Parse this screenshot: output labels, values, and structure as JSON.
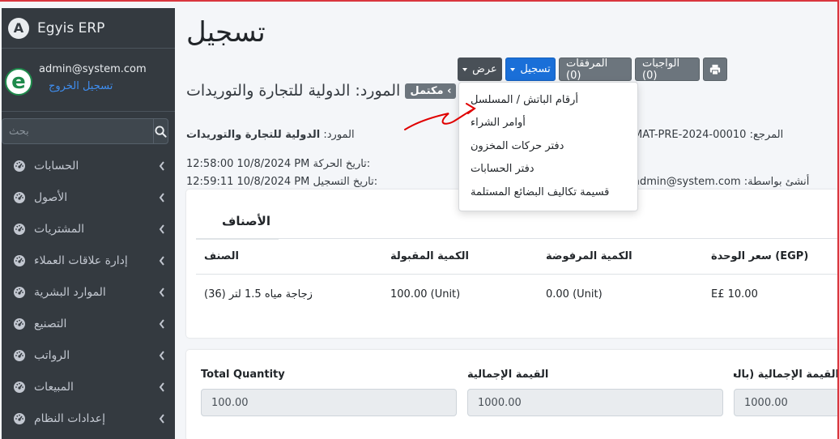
{
  "brand": {
    "name": "Egyis ERP",
    "logo_letter": "A"
  },
  "user": {
    "email": "admin@system.com",
    "logout": "تسجيل الخروج",
    "avatar_letter": "e"
  },
  "search": {
    "placeholder": "بحث"
  },
  "sidebar": {
    "items": [
      {
        "label": "الحسابات",
        "icon": "gauge-icon"
      },
      {
        "label": "الأصول",
        "icon": "gauge-icon"
      },
      {
        "label": "المشتريات",
        "icon": "gauge-icon"
      },
      {
        "label": "إدارة علاقات العملاء",
        "icon": "gauge-icon"
      },
      {
        "label": "الموارد البشرية",
        "icon": "gauge-icon"
      },
      {
        "label": "التصنيع",
        "icon": "gauge-icon"
      },
      {
        "label": "الرواتب",
        "icon": "gauge-icon"
      },
      {
        "label": "المبيعات",
        "icon": "gauge-icon"
      },
      {
        "label": "إعدادات النظام",
        "icon": "gauge-icon"
      }
    ]
  },
  "page": {
    "title": "تسجيل"
  },
  "toolbar": {
    "print_icon": "print-icon",
    "duties": "الواجبات (0)",
    "attachments": "المرفقات (0)",
    "register": "تسجيل",
    "view": "عرض"
  },
  "header": {
    "badge": "مكتمل ‹",
    "supplier": "المورد: الدولية للتجارة والتوريدات"
  },
  "info": {
    "supplier_label": "المورد:",
    "supplier_value": "الدولية للتجارة والتوريدات",
    "movement_date": "12:58:00 10/8/2024 PM تاريخ الحركة:",
    "register_date": "12:59:11 10/8/2024 PM تاريخ التسجيل:",
    "reference": "MAT-PRE-2024-00010 :المرجع",
    "created_by": "admin@system.com :أنشئ بواسطة"
  },
  "dropdown": {
    "items": [
      "أرقام الباتش / المسلسل",
      "أوامر الشراء",
      "دفتر حركات المخزون",
      "دفتر الحسابات",
      "قسيمة تكاليف البضائع المستلمة"
    ]
  },
  "items_tab": {
    "label": "الأصناف"
  },
  "table": {
    "headers": [
      "الصنف",
      "الكمية المقبولة",
      "الكمية المرفوضة",
      "سعر الوحدة (EGP)"
    ],
    "rows": [
      {
        "item": "زجاجة مياه 1.5 لتر (36)",
        "accepted": "100.00 (Unit)",
        "rejected": "0.00 (Unit)",
        "price": "E£ 10.00"
      }
    ]
  },
  "totals": {
    "total_qty_label": "Total Quantity",
    "total_qty": "100.00",
    "total_value_label": "القيمة الإجمالية",
    "total_value": "1000.00",
    "base_total_label": "القيمة الإجمالية (بالعملة الرئيسية)",
    "base_total": "1000.00"
  }
}
